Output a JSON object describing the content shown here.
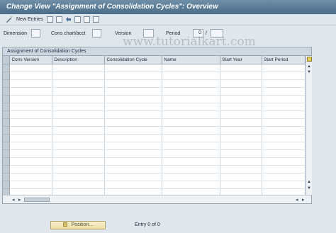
{
  "window": {
    "title": "Change View \"Assignment of Consolidation Cycles\": Overview"
  },
  "toolbar": {
    "new_entries_label": "New Entries"
  },
  "filters": {
    "dimension_label": "Dimension",
    "dimension_value": "",
    "cons_chart_label": "Cons chart/acct",
    "cons_chart_value": "",
    "version_label": "Version",
    "version_value": "",
    "period_label": "Period",
    "period_value": "0",
    "period_separator": "/",
    "year_value": ""
  },
  "table": {
    "title": "Assignment of Consolidation Cycles",
    "columns": [
      "Cons Version",
      "Description",
      "Consolidation Cycle",
      "Name",
      "Start Year",
      "Start Period"
    ],
    "rows": []
  },
  "footer": {
    "position_label": "Position...",
    "entry_text": "Entry 0 of 0"
  },
  "watermark": "www.tutorialkart.com",
  "colors": {
    "title_bar": "#5a7a96",
    "background": "#dfe6ec",
    "button": "#f3e7b3"
  }
}
